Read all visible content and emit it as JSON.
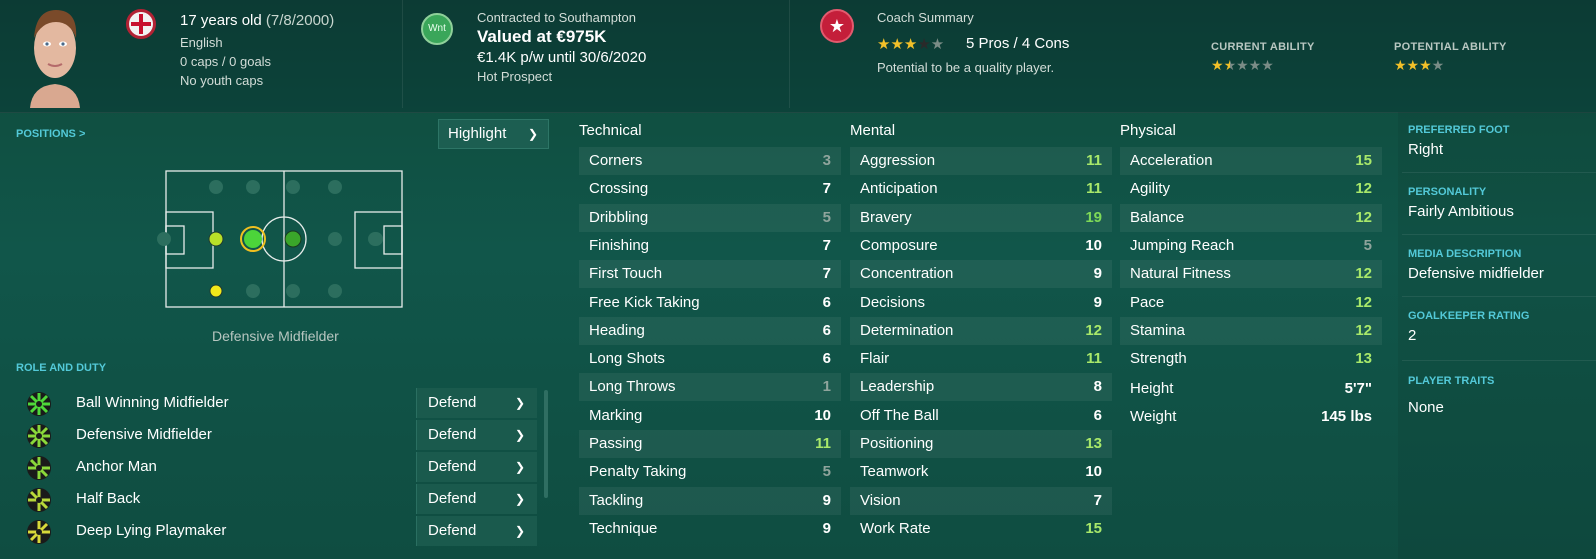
{
  "header": {
    "age_text": "17 years old",
    "dob_text": "(7/8/2000)",
    "nationality": "English",
    "caps": "0 caps / 0 goals",
    "youth_caps": "No youth caps",
    "club_badge": "Wnt",
    "contract": "Contracted to Southampton",
    "value": "Valued at €975K",
    "wage": "€1.4K p/w until 30/6/2020",
    "status": "Hot Prospect",
    "coach_summary_title": "Coach Summary",
    "coach_stars": 3,
    "pros_cons": "5 Pros / 4 Cons",
    "coach_note": "Potential to be a quality player.",
    "current_ability_label": "CURRENT ABILITY",
    "current_ability_stars": 1.5,
    "potential_ability_label": "POTENTIAL ABILITY",
    "potential_ability_stars": 3
  },
  "positions": {
    "title": "POSITIONS >",
    "highlight_label": "Highlight",
    "caption": "Defensive Midfielder"
  },
  "roles": {
    "title": "ROLE AND DUTY",
    "items": [
      {
        "name": "Ball Winning Midfielder",
        "duty": "Defend"
      },
      {
        "name": "Defensive Midfielder",
        "duty": "Defend"
      },
      {
        "name": "Anchor Man",
        "duty": "Defend"
      },
      {
        "name": "Half Back",
        "duty": "Defend"
      },
      {
        "name": "Deep Lying Playmaker",
        "duty": "Defend"
      }
    ]
  },
  "technical": {
    "title": "Technical",
    "items": [
      {
        "name": "Corners",
        "value": "3"
      },
      {
        "name": "Crossing",
        "value": "7"
      },
      {
        "name": "Dribbling",
        "value": "5"
      },
      {
        "name": "Finishing",
        "value": "7"
      },
      {
        "name": "First Touch",
        "value": "7"
      },
      {
        "name": "Free Kick Taking",
        "value": "6"
      },
      {
        "name": "Heading",
        "value": "6"
      },
      {
        "name": "Long Shots",
        "value": "6"
      },
      {
        "name": "Long Throws",
        "value": "1"
      },
      {
        "name": "Marking",
        "value": "10"
      },
      {
        "name": "Passing",
        "value": "11"
      },
      {
        "name": "Penalty Taking",
        "value": "5"
      },
      {
        "name": "Tackling",
        "value": "9"
      },
      {
        "name": "Technique",
        "value": "9"
      }
    ]
  },
  "mental": {
    "title": "Mental",
    "items": [
      {
        "name": "Aggression",
        "value": "11"
      },
      {
        "name": "Anticipation",
        "value": "11"
      },
      {
        "name": "Bravery",
        "value": "19"
      },
      {
        "name": "Composure",
        "value": "10"
      },
      {
        "name": "Concentration",
        "value": "9"
      },
      {
        "name": "Decisions",
        "value": "9"
      },
      {
        "name": "Determination",
        "value": "12"
      },
      {
        "name": "Flair",
        "value": "11"
      },
      {
        "name": "Leadership",
        "value": "8"
      },
      {
        "name": "Off The Ball",
        "value": "6"
      },
      {
        "name": "Positioning",
        "value": "13"
      },
      {
        "name": "Teamwork",
        "value": "10"
      },
      {
        "name": "Vision",
        "value": "7"
      },
      {
        "name": "Work Rate",
        "value": "15"
      }
    ]
  },
  "physical": {
    "title": "Physical",
    "items": [
      {
        "name": "Acceleration",
        "value": "15"
      },
      {
        "name": "Agility",
        "value": "12"
      },
      {
        "name": "Balance",
        "value": "12"
      },
      {
        "name": "Jumping Reach",
        "value": "5"
      },
      {
        "name": "Natural Fitness",
        "value": "12"
      },
      {
        "name": "Pace",
        "value": "12"
      },
      {
        "name": "Stamina",
        "value": "12"
      },
      {
        "name": "Strength",
        "value": "13"
      }
    ],
    "height_label": "Height",
    "height_value": "5'7\"",
    "weight_label": "Weight",
    "weight_value": "145 lbs"
  },
  "info": {
    "preferred_foot_label": "PREFERRED FOOT",
    "preferred_foot": "Right",
    "personality_label": "PERSONALITY",
    "personality": "Fairly Ambitious",
    "media_label": "MEDIA DESCRIPTION",
    "media": "Defensive midfielder",
    "gk_label": "GOALKEEPER RATING",
    "gk": "2",
    "traits_label": "PLAYER TRAITS",
    "traits": "None"
  }
}
